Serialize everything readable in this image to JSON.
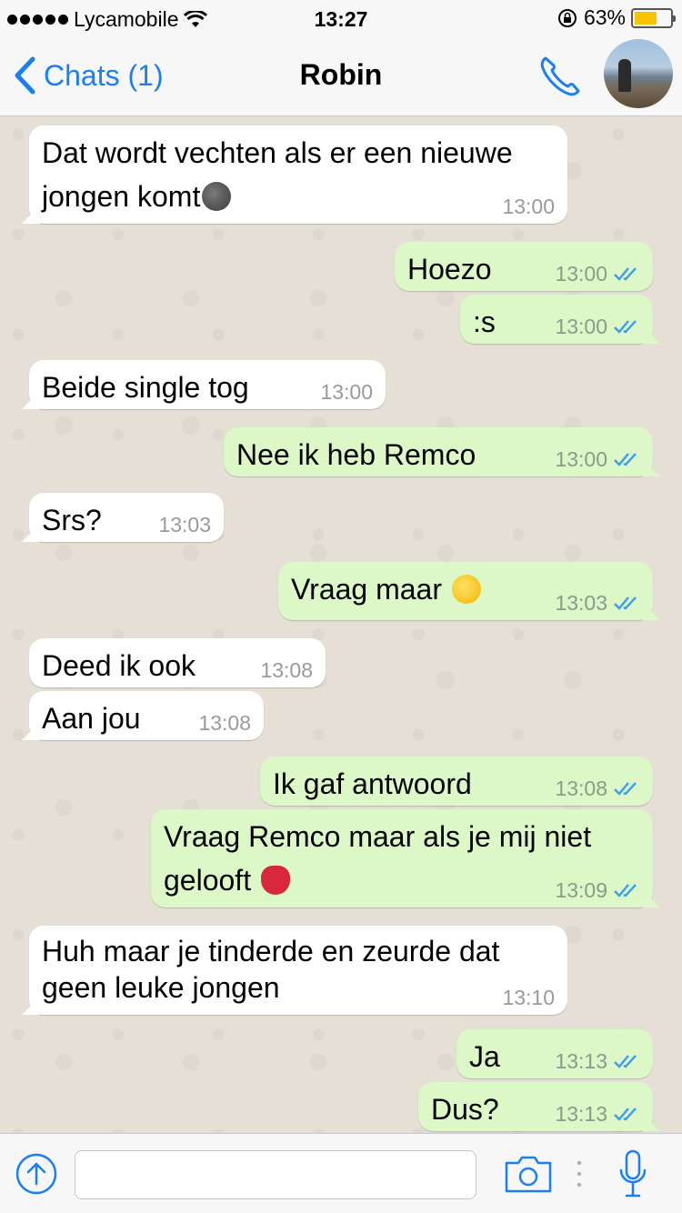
{
  "status_bar": {
    "carrier": "Lycamobile",
    "time": "13:27",
    "battery": "63%",
    "battery_level": 0.63
  },
  "nav": {
    "back_label": "Chats (1)",
    "title": "Robin"
  },
  "messages": [
    {
      "dir": "in",
      "line1": "Dat wordt vechten als er een nieuwe",
      "line2": "jongen komt",
      "emoji": "new-moon-face",
      "time": "13:00"
    },
    {
      "dir": "out",
      "text": "Hoezo",
      "time": "13:00"
    },
    {
      "dir": "out",
      "text": ":s",
      "time": "13:00"
    },
    {
      "dir": "in",
      "text": "Beide single tog",
      "time": "13:00"
    },
    {
      "dir": "out",
      "text": "Nee ik heb Remco",
      "time": "13:00"
    },
    {
      "dir": "in",
      "text": "Srs?",
      "time": "13:03"
    },
    {
      "dir": "out",
      "text": "Vraag maar",
      "emoji": "winking-tongue-face",
      "time": "13:03"
    },
    {
      "dir": "in",
      "text": "Deed ik ook",
      "time": "13:08"
    },
    {
      "dir": "in",
      "text": "Aan jou",
      "time": "13:08"
    },
    {
      "dir": "out",
      "text": "Ik gaf antwoord",
      "time": "13:08"
    },
    {
      "dir": "out",
      "line1": "Vraag Remco maar als je mij niet",
      "line2": "gelooft",
      "emoji": "japanese-goblin",
      "time": "13:09"
    },
    {
      "dir": "in",
      "line1": "Huh maar je tinderde en zeurde dat",
      "line2": "geen leuke jongen",
      "time": "13:10"
    },
    {
      "dir": "out",
      "text": "Ja",
      "time": "13:13"
    },
    {
      "dir": "out",
      "text": "Dus?",
      "time": "13:13"
    }
  ],
  "input": {
    "placeholder": ""
  },
  "colors": {
    "accent": "#1a7ff2",
    "outgoing_bubble": "#dcf8c6",
    "incoming_bubble": "#ffffff",
    "read_ticks": "#3a9bf0"
  }
}
